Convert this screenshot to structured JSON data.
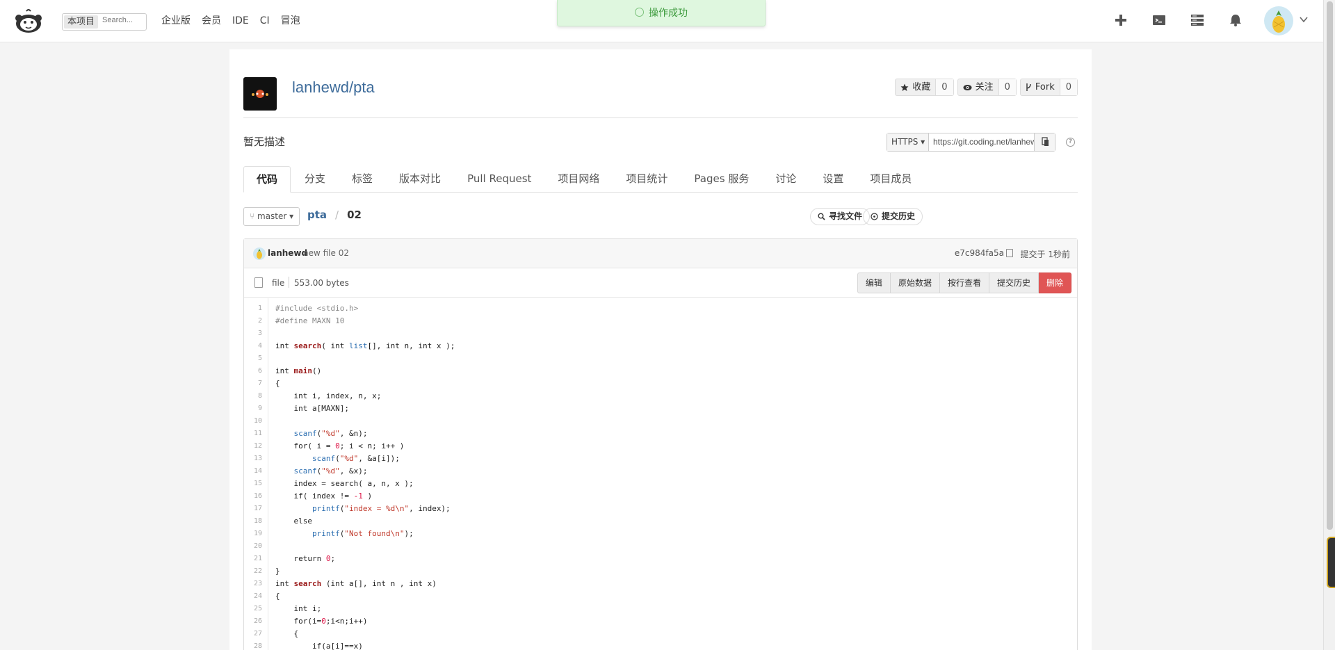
{
  "topbar": {
    "scope_label": "本项目",
    "search_placeholder": "Search...",
    "nav": [
      "企业版",
      "会员",
      "IDE",
      "CI",
      "冒泡"
    ],
    "toast": "操作成功"
  },
  "repo": {
    "full_name": "lanhewd/pta",
    "star_label": "收藏",
    "star_count": "0",
    "watch_label": "关注",
    "watch_count": "0",
    "fork_label": "Fork",
    "fork_count": "0",
    "description": "暂无描述",
    "clone_protocol": "HTTPS",
    "clone_url": "https://git.coding.net/lanhewd/pta.git"
  },
  "tabs": [
    "代码",
    "分支",
    "标签",
    "版本对比",
    "Pull Request",
    "项目网络",
    "项目统计",
    "Pages 服务",
    "讨论",
    "设置",
    "项目成员"
  ],
  "file_nav": {
    "branch": "master",
    "repo": "pta",
    "file": "02",
    "find_file": "寻找文件",
    "history": "提交历史"
  },
  "commit": {
    "author": "lanhewd",
    "message": "new file 02",
    "sha": "e7c984fa5a",
    "time": "提交于 1秒前"
  },
  "file_info": {
    "type": "file",
    "size": "553.00 bytes",
    "actions": [
      "编辑",
      "原始数据",
      "按行查看",
      "提交历史",
      "删除"
    ]
  },
  "colors": {
    "link": "#3d6b9a",
    "danger": "#e05555",
    "toast_bg": "#dff7df"
  }
}
